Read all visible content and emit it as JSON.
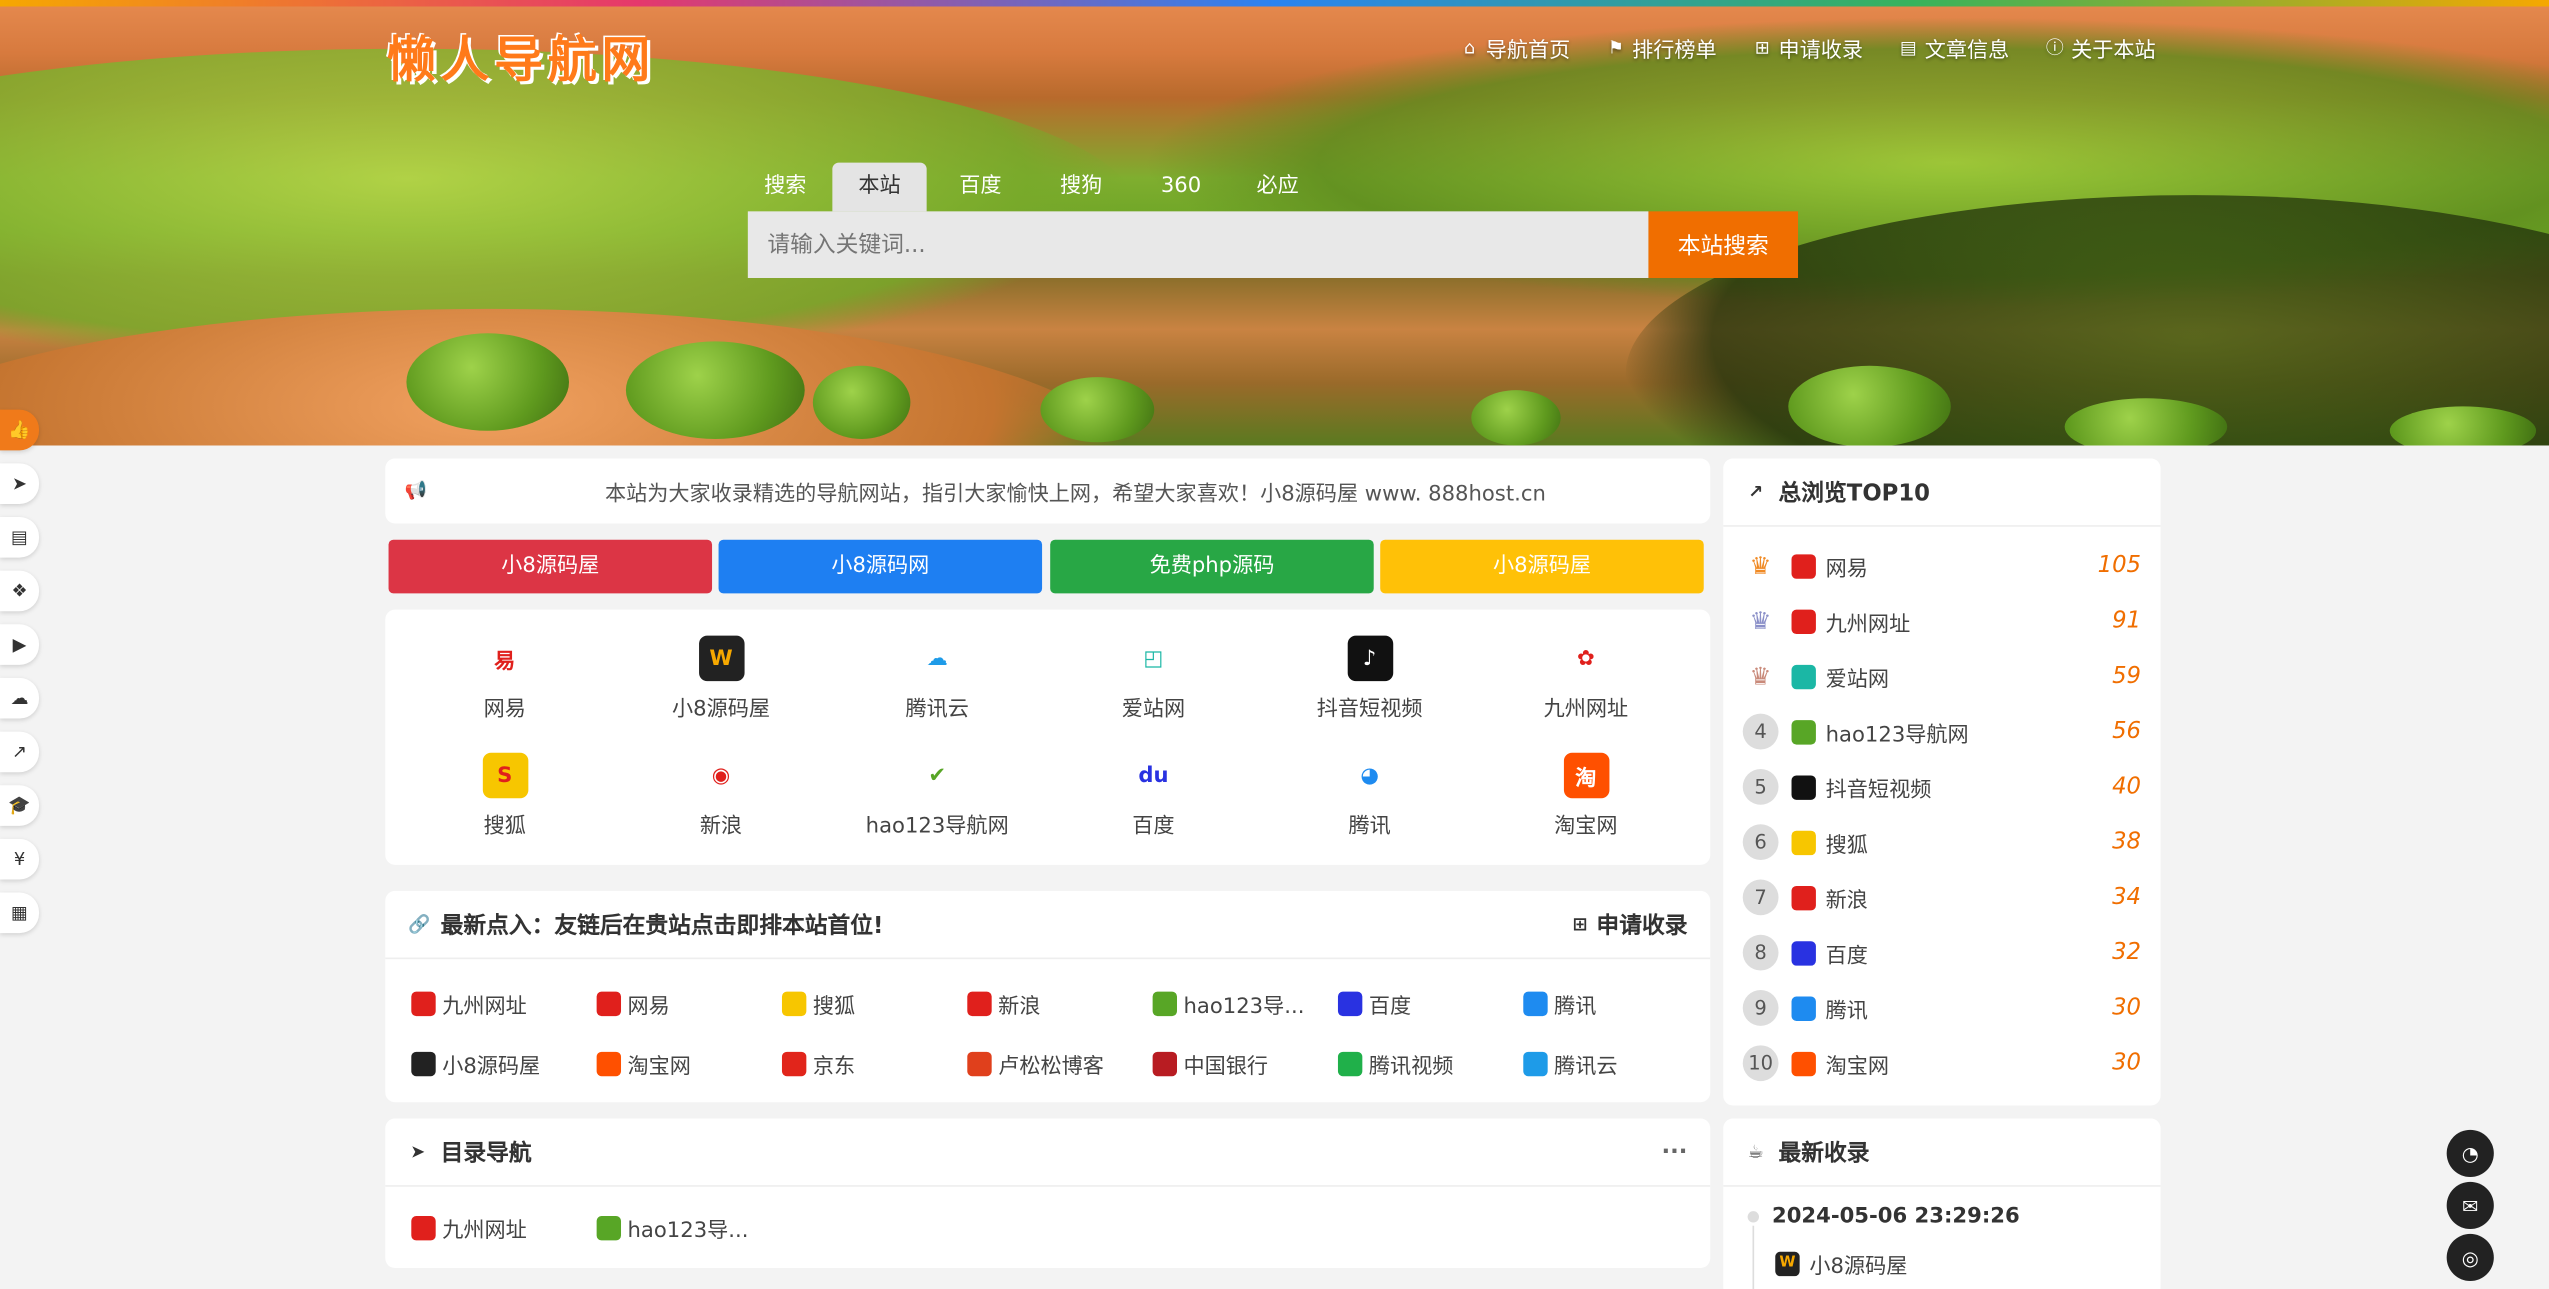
{
  "header": {
    "logo": "懒人导航网",
    "nav": [
      {
        "icon": "home-icon",
        "glyph": "⌂",
        "label": "导航首页"
      },
      {
        "icon": "flag-icon",
        "glyph": "⚑",
        "label": "排行榜单"
      },
      {
        "icon": "plus-square-icon",
        "glyph": "⊞",
        "label": "申请收录"
      },
      {
        "icon": "book-icon",
        "glyph": "▤",
        "label": "文章信息"
      },
      {
        "icon": "info-icon",
        "glyph": "ⓘ",
        "label": "关于本站"
      }
    ]
  },
  "search": {
    "tabs": [
      "搜索",
      "本站",
      "百度",
      "搜狗",
      "360",
      "必应"
    ],
    "active_tab": "本站",
    "placeholder": "请输入关键词...",
    "button": "本站搜索"
  },
  "sidebar": [
    "thumbs-up-icon",
    "paper-plane-icon",
    "file-icon",
    "cubes-icon",
    "youtube-icon",
    "cloud-icon",
    "line-chart-icon",
    "graduation-cap-icon",
    "yen-icon",
    "th-large-icon"
  ],
  "notice": {
    "text": "本站为大家收录精选的导航网站，指引大家愉快上网，希望大家喜欢！小8源码屋 www. 888host.cn"
  },
  "color_buttons": [
    {
      "label": "小8源码屋",
      "color": "#dc3545"
    },
    {
      "label": "小8源码网",
      "color": "#1e7ff2"
    },
    {
      "label": "免费php源码",
      "color": "#28a745"
    },
    {
      "label": "小8源码屋",
      "color": "#ffc107"
    }
  ],
  "apps": [
    {
      "label": "网易",
      "glyph": "易",
      "bg": "#fff",
      "fg": "#e0201c"
    },
    {
      "label": "小8源码屋",
      "glyph": "W",
      "bg": "#222",
      "fg": "#f6a800"
    },
    {
      "label": "腾讯云",
      "glyph": "☁",
      "bg": "#fff",
      "fg": "#1e9be8"
    },
    {
      "label": "爱站网",
      "glyph": "◰",
      "bg": "#fff",
      "fg": "#1bb7a5"
    },
    {
      "label": "抖音短视频",
      "glyph": "♪",
      "bg": "#111",
      "fg": "#fff"
    },
    {
      "label": "九州网址",
      "glyph": "✿",
      "bg": "#fff",
      "fg": "#e0201c"
    },
    {
      "label": "搜狐",
      "glyph": "S",
      "bg": "#f7c600",
      "fg": "#e0201c"
    },
    {
      "label": "新浪",
      "glyph": "◉",
      "bg": "#fff",
      "fg": "#e0201c"
    },
    {
      "label": "hao123导航网",
      "glyph": "✔",
      "bg": "#fff",
      "fg": "#58a626"
    },
    {
      "label": "百度",
      "glyph": "du",
      "bg": "#fff",
      "fg": "#2932e1"
    },
    {
      "label": "腾讯",
      "glyph": "◕",
      "bg": "#fff",
      "fg": "#1e8bf0"
    },
    {
      "label": "淘宝网",
      "glyph": "淘",
      "bg": "#ff5000",
      "fg": "#fff"
    }
  ],
  "latest_in": {
    "title": "最新点入：友链后在贵站点击即排本站首位!",
    "action": "申请收录",
    "items": [
      {
        "label": "九州网址",
        "bg": "#e0201c"
      },
      {
        "label": "网易",
        "bg": "#e0201c"
      },
      {
        "label": "搜狐",
        "bg": "#f7c600"
      },
      {
        "label": "新浪",
        "bg": "#e0201c"
      },
      {
        "label": "hao123导...",
        "bg": "#58a626"
      },
      {
        "label": "百度",
        "bg": "#2932e1"
      },
      {
        "label": "腾讯",
        "bg": "#1e8bf0"
      },
      {
        "label": "小8源码屋",
        "bg": "#222"
      },
      {
        "label": "淘宝网",
        "bg": "#ff5000"
      },
      {
        "label": "京东",
        "bg": "#e1251b"
      },
      {
        "label": "卢松松博客",
        "bg": "#e0401c"
      },
      {
        "label": "中国银行",
        "bg": "#b81c22"
      },
      {
        "label": "腾讯视频",
        "bg": "#20b04a"
      },
      {
        "label": "腾讯云",
        "bg": "#1e9be8"
      }
    ]
  },
  "directory": {
    "title": "目录导航",
    "more": "···",
    "items": [
      {
        "label": "九州网址",
        "bg": "#e0201c"
      },
      {
        "label": "hao123导...",
        "bg": "#58a626"
      }
    ]
  },
  "top10": {
    "title": "总浏览TOP10",
    "rows": [
      {
        "rank": "1",
        "name": "网易",
        "count": "105",
        "bg": "#e0201c"
      },
      {
        "rank": "2",
        "name": "九州网址",
        "count": "91",
        "bg": "#e0201c"
      },
      {
        "rank": "3",
        "name": "爱站网",
        "count": "59",
        "bg": "#1bb7a5"
      },
      {
        "rank": "4",
        "name": "hao123导航网",
        "count": "56",
        "bg": "#58a626"
      },
      {
        "rank": "5",
        "name": "抖音短视频",
        "count": "40",
        "bg": "#111"
      },
      {
        "rank": "6",
        "name": "搜狐",
        "count": "38",
        "bg": "#f7c600"
      },
      {
        "rank": "7",
        "name": "新浪",
        "count": "34",
        "bg": "#e0201c"
      },
      {
        "rank": "8",
        "name": "百度",
        "count": "32",
        "bg": "#2932e1"
      },
      {
        "rank": "9",
        "name": "腾讯",
        "count": "30",
        "bg": "#1e8bf0"
      },
      {
        "rank": "10",
        "name": "淘宝网",
        "count": "30",
        "bg": "#ff5000"
      }
    ],
    "crown_colors": [
      "#f08a24",
      "#8a8fc8",
      "#c98a7a"
    ]
  },
  "latest": {
    "title": "最新收录",
    "date": "2024-05-06 23:29:26",
    "item": "小8源码屋"
  },
  "float_buttons": [
    "qq-icon",
    "envelope-icon",
    "wechat-icon"
  ]
}
